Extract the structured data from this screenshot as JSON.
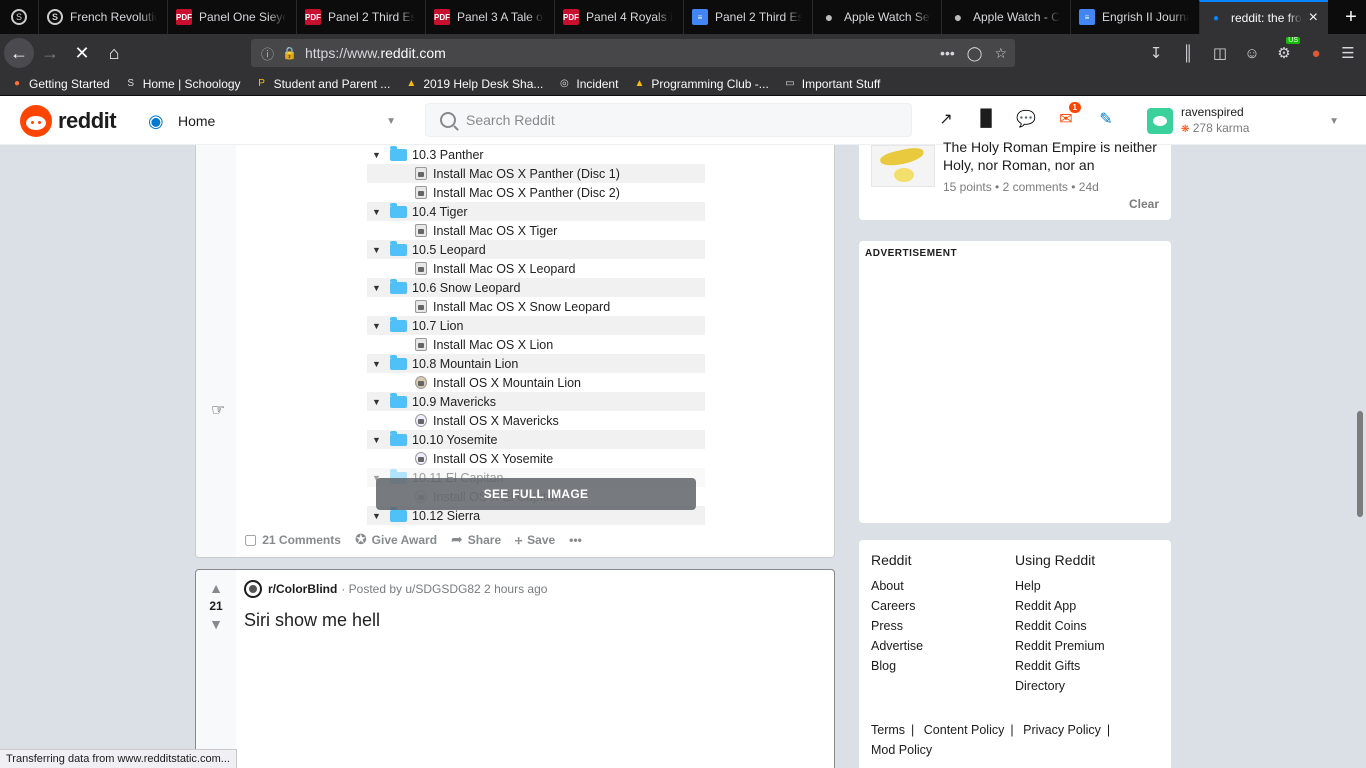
{
  "browser": {
    "tabs": [
      {
        "label": "French Revolutio",
        "favicon": "schoology-icon"
      },
      {
        "label": "Panel One Sieyes",
        "favicon": "pdf-icon"
      },
      {
        "label": "Panel 2 Third Est",
        "favicon": "pdf-icon"
      },
      {
        "label": "Panel 3 A Tale of",
        "favicon": "pdf-icon"
      },
      {
        "label": "Panel 4 Royals in",
        "favicon": "pdf-icon"
      },
      {
        "label": "Panel 2 Third Est",
        "favicon": "docs-icon"
      },
      {
        "label": "Apple Watch Ser",
        "favicon": "apple-icon"
      },
      {
        "label": "Apple Watch - C",
        "favicon": "apple-icon"
      },
      {
        "label": "Engrish II Journa",
        "favicon": "docs-icon"
      },
      {
        "label": "reddit: the fro",
        "favicon": "loading-dot-icon",
        "active": true
      }
    ],
    "url_prefix": "https://www.",
    "url_domain": "reddit.com",
    "bookmarks": [
      {
        "label": "Getting Started",
        "icon": "firefox-icon"
      },
      {
        "label": "Home | Schoology",
        "icon": "schoology-icon"
      },
      {
        "label": "Student and Parent ...",
        "icon": "p-icon"
      },
      {
        "label": "2019 Help Desk Sha...",
        "icon": "drive-icon"
      },
      {
        "label": "Incident",
        "icon": "globe-icon"
      },
      {
        "label": "Programming Club -...",
        "icon": "drive-icon"
      },
      {
        "label": "Important Stuff",
        "icon": "folder-icon"
      }
    ],
    "extension_badge": "US",
    "status_text": "Transferring data from www.redditstatic.com..."
  },
  "header": {
    "logo_text": "reddit",
    "feed_label": "Home",
    "search_placeholder": "Search Reddit",
    "notif_count": "1",
    "username": "ravenspired",
    "karma": "278 karma"
  },
  "post1": {
    "tree": [
      {
        "type": "folder",
        "name": "10.3 Panther",
        "alt": false
      },
      {
        "type": "leaf",
        "name": "Install Mac OS X Panther (Disc 1)",
        "alt": true,
        "icon": "disk"
      },
      {
        "type": "leaf",
        "name": "Install Mac OS X Panther (Disc 2)",
        "alt": false,
        "icon": "disk"
      },
      {
        "type": "folder",
        "name": "10.4 Tiger",
        "alt": true
      },
      {
        "type": "leaf",
        "name": "Install Mac OS X Tiger",
        "alt": false,
        "icon": "disk"
      },
      {
        "type": "folder",
        "name": "10.5 Leopard",
        "alt": true
      },
      {
        "type": "leaf",
        "name": "Install Mac OS X Leopard",
        "alt": false,
        "icon": "disk"
      },
      {
        "type": "folder",
        "name": "10.6 Snow Leopard",
        "alt": true
      },
      {
        "type": "leaf",
        "name": "Install Mac OS X Snow Leopard",
        "alt": false,
        "icon": "disk"
      },
      {
        "type": "folder",
        "name": "10.7 Lion",
        "alt": true
      },
      {
        "type": "leaf",
        "name": "Install Mac OS X Lion",
        "alt": false,
        "icon": "disk"
      },
      {
        "type": "folder",
        "name": "10.8 Mountain Lion",
        "alt": true
      },
      {
        "type": "leaf",
        "name": "Install OS X Mountain Lion",
        "alt": false,
        "icon": "round"
      },
      {
        "type": "folder",
        "name": "10.9 Mavericks",
        "alt": true
      },
      {
        "type": "leaf",
        "name": "Install OS X Mavericks",
        "alt": false,
        "icon": "round-light"
      },
      {
        "type": "folder",
        "name": "10.10 Yosemite",
        "alt": true
      },
      {
        "type": "leaf",
        "name": "Install OS X Yosemite",
        "alt": false,
        "icon": "round-light"
      },
      {
        "type": "folder",
        "name": "10.11 El Capitan",
        "alt": true,
        "faded": true
      },
      {
        "type": "leaf",
        "name": "Install OS X El Capitan",
        "alt": false,
        "icon": "round-light",
        "faded": true
      },
      {
        "type": "folder",
        "name": "10.12 Sierra",
        "alt": true
      }
    ],
    "see_full_image": "SEE FULL IMAGE",
    "comments": "21 Comments",
    "give_award": "Give Award",
    "share": "Share",
    "save": "Save",
    "more": "•••"
  },
  "post2": {
    "score": "21",
    "subreddit": "r/ColorBlind",
    "posted_by": "· Posted by u/SDGSDG82 2 hours ago",
    "title": "Siri show me hell"
  },
  "sidebar": {
    "recent": {
      "title": "The Holy Roman Empire is neither Holy, nor Roman, nor an",
      "meta": "15 points • 2 comments • 24d",
      "clear": "Clear"
    },
    "ad_label": "ADVERTISEMENT",
    "footer": {
      "col1_title": "Reddit",
      "col1_links": [
        "About",
        "Careers",
        "Press",
        "Advertise",
        "Blog"
      ],
      "col2_title": "Using Reddit",
      "col2_links": [
        "Help",
        "Reddit App",
        "Reddit Coins",
        "Reddit Premium",
        "Reddit Gifts",
        "Directory"
      ],
      "terms": "Terms",
      "content_policy": "Content Policy",
      "privacy_policy": "Privacy Policy",
      "mod_policy": "Mod Policy"
    }
  },
  "colors": {
    "reddit_orange": "#ff4500",
    "reddit_blue": "#0079d3",
    "page_bg": "#dae0e6",
    "folder_blue": "#4fc0f8"
  }
}
